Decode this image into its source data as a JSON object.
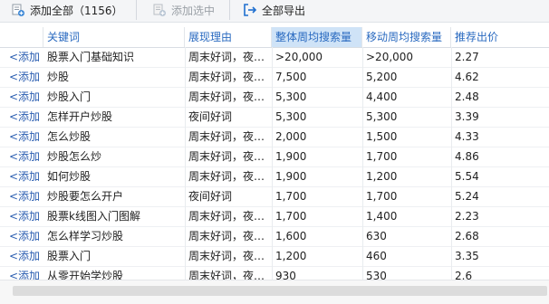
{
  "toolbar": {
    "add_all_label": "添加全部（1156）",
    "add_selected_label": "添加选中",
    "export_all_label": "全部导出"
  },
  "table": {
    "columns": [
      "关键词",
      "展现理由",
      "整体周均搜索量",
      "移动周均搜索量",
      "推荐出价"
    ],
    "add_label": "<添加",
    "rows": [
      {
        "keyword": "股票入门基础知识",
        "reason": "周末好词，夜…",
        "overall": ">20,000",
        "mobile": ">20,000",
        "bid": "2.27"
      },
      {
        "keyword": "炒股",
        "reason": "周末好词，夜…",
        "overall": "7,500",
        "mobile": "5,200",
        "bid": "4.62"
      },
      {
        "keyword": "炒股入门",
        "reason": "周末好词，夜…",
        "overall": "5,300",
        "mobile": "4,400",
        "bid": "2.48"
      },
      {
        "keyword": "怎样开户炒股",
        "reason": "夜间好词",
        "overall": "5,300",
        "mobile": "5,300",
        "bid": "3.39"
      },
      {
        "keyword": "怎么炒股",
        "reason": "周末好词，夜…",
        "overall": "2,000",
        "mobile": "1,500",
        "bid": "4.33"
      },
      {
        "keyword": "炒股怎么炒",
        "reason": "周末好词，夜…",
        "overall": "1,900",
        "mobile": "1,700",
        "bid": "4.86"
      },
      {
        "keyword": "如何炒股",
        "reason": "周末好词，夜…",
        "overall": "1,900",
        "mobile": "1,200",
        "bid": "5.54"
      },
      {
        "keyword": "炒股要怎么开户",
        "reason": "夜间好词",
        "overall": "1,700",
        "mobile": "1,700",
        "bid": "5.24"
      },
      {
        "keyword": "股票k线图入门图解",
        "reason": "周末好词，夜…",
        "overall": "1,700",
        "mobile": "1,400",
        "bid": "2.23"
      },
      {
        "keyword": "怎么样学习炒股",
        "reason": "周末好词，夜…",
        "overall": "1,600",
        "mobile": "630",
        "bid": "2.68"
      },
      {
        "keyword": "股票入门",
        "reason": "周末好词，夜…",
        "overall": "1,200",
        "mobile": "460",
        "bid": "3.35"
      },
      {
        "keyword": "从零开始学炒股",
        "reason": "周末好词，夜…",
        "overall": "930",
        "mobile": "530",
        "bid": "2.6"
      }
    ]
  },
  "icons": {
    "add_all": "add-all-icon",
    "add_selected": "add-selected-icon",
    "export": "export-icon"
  },
  "colors": {
    "link": "#2a5db0",
    "header_text": "#2a6ac0",
    "sorted_header_bg": "#cfe3f7",
    "export_icon": "#1f6fcf"
  }
}
